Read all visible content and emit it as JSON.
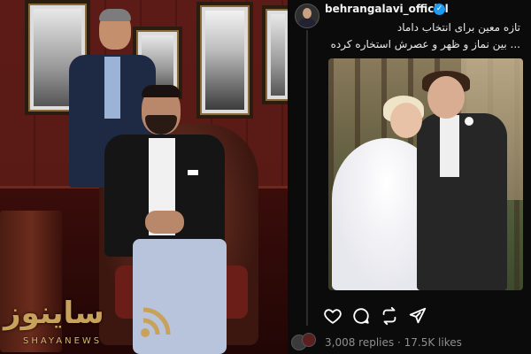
{
  "post": {
    "username": "behrangalavi_official",
    "verified_mark": "✓",
    "caption_line1": "تازه معین برای انتخاب داماد",
    "caption_line2": "... بین نماز و ظهر و عصرش استخاره کرده",
    "replies": "3,008 replies",
    "separator": "·",
    "likes": "17.5K likes"
  },
  "actions": {
    "like_icon": "heart-icon",
    "reply_icon": "comment-icon",
    "repost_icon": "repost-icon",
    "share_icon": "send-icon"
  },
  "watermark": {
    "main": "ساینوز",
    "sub": "SHAYANEWS",
    "color": "#c8a15a"
  },
  "colors": {
    "background": "#0b0b0b",
    "verified": "#1d9bf0",
    "muted_text": "#8f8f8f"
  }
}
